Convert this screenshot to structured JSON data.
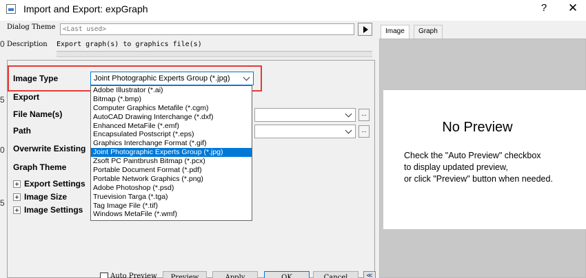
{
  "window": {
    "title": "Import and Export: expGraph",
    "help_glyph": "?",
    "close_glyph": "✕"
  },
  "dialog_theme": {
    "label": "Dialog Theme",
    "placeholder": "<Last used>"
  },
  "description": {
    "label": "Description",
    "value": "Export graph(s) to graphics file(s)"
  },
  "left_edge": {
    "glyph_a": "0",
    "glyph_b": "5",
    "glyph_c": "0",
    "glyph_d": "5"
  },
  "form": {
    "image_type_label": "Image Type",
    "image_type_value": "Joint Photographic Experts Group (*.jpg)",
    "export_label": "Export",
    "file_names_label": "File Name(s)",
    "path_label": "Path",
    "overwrite_label": "Overwrite Existing",
    "graph_theme_label": "Graph Theme",
    "export_settings_label": "Export Settings",
    "image_size_label": "Image Size",
    "image_settings_label": "Image Settings",
    "browse_label": "..."
  },
  "dropdown_items": [
    "Adobe Illustrator (*.ai)",
    "Bitmap (*.bmp)",
    "Computer Graphics Metafile (*.cgm)",
    "AutoCAD Drawing Interchange (*.dxf)",
    "Enhanced MetaFile (*.emf)",
    "Encapsulated Postscript (*.eps)",
    "Graphics Interchange Format (*.gif)",
    "Joint Photographic Experts Group (*.jpg)",
    "Zsoft PC Paintbrush Bitmap (*.pcx)",
    "Portable Document Format (*.pdf)",
    "Portable Network Graphics (*.png)",
    "Adobe Photoshop (*.psd)",
    "Truevision Targa (*.tga)",
    "Tag Image File (*.tif)",
    "Windows MetaFile (*.wmf)"
  ],
  "selected_index": 7,
  "buttons": {
    "auto_preview": "Auto Preview",
    "preview": "Preview",
    "apply": "Apply",
    "ok": "OK",
    "cancel": "Cancel",
    "extra": "≪"
  },
  "tabs": {
    "image": "Image",
    "graph": "Graph"
  },
  "preview": {
    "no_preview": "No Preview",
    "hint_line1": "Check the \"Auto Preview\" checkbox",
    "hint_line2": "to display updated preview,",
    "hint_line3": "or click \"Preview\" button when needed."
  }
}
